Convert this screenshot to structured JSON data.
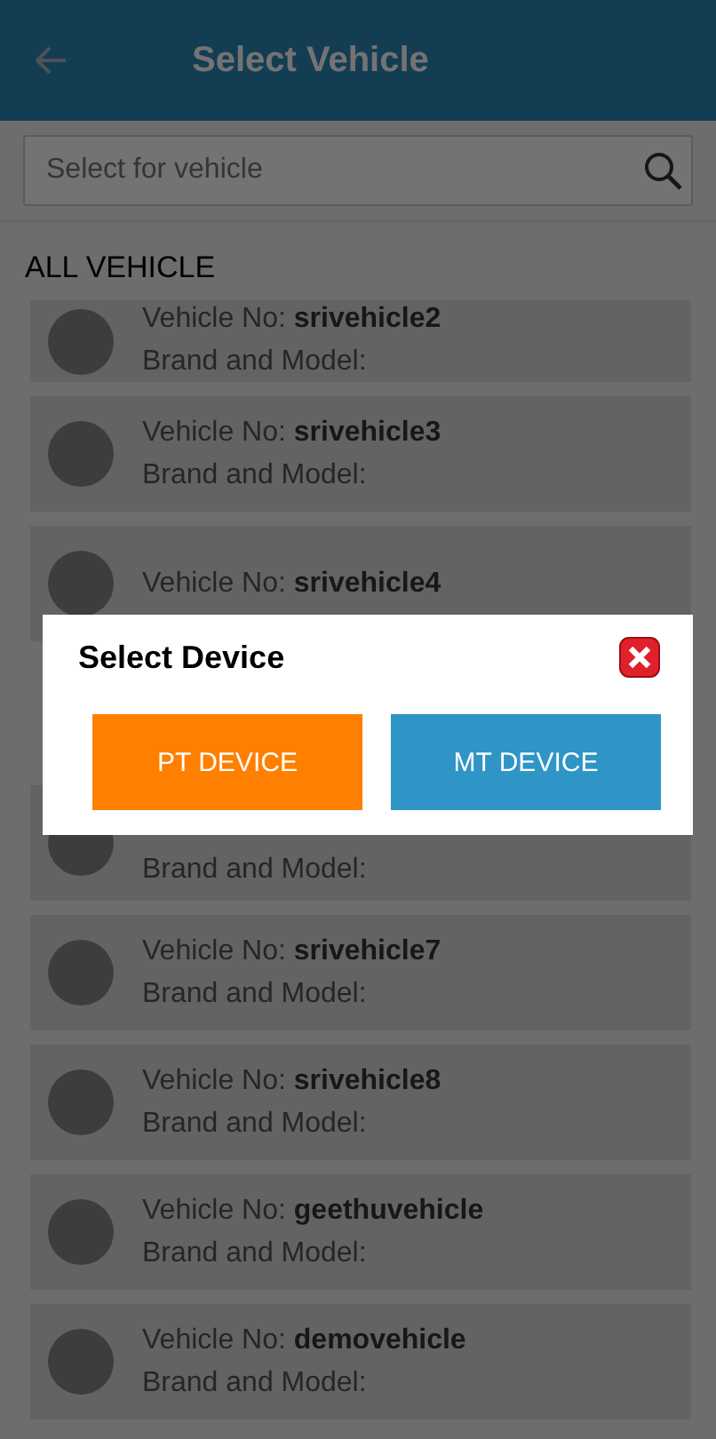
{
  "header": {
    "title": "Select Vehicle"
  },
  "search": {
    "placeholder": "Select for vehicle"
  },
  "section_title": "ALL VEHICLE",
  "vehicles": [
    {
      "label": "Vehicle No:",
      "number": "srivehicle2",
      "brand_label": "Brand and Model:"
    },
    {
      "label": "Vehicle No:",
      "number": "srivehicle3",
      "brand_label": "Brand and Model:"
    },
    {
      "label": "Vehicle No:",
      "number": "srivehicle4"
    },
    {
      "brand_label": "Brand and Model:"
    },
    {
      "label": "Vehicle No:",
      "number": "srivehicle7",
      "brand_label": "Brand and Model:"
    },
    {
      "label": "Vehicle No:",
      "number": "srivehicle8",
      "brand_label": "Brand and Model:"
    },
    {
      "label": "Vehicle No:",
      "number": "geethuvehicle",
      "brand_label": "Brand and Model:"
    },
    {
      "label": "Vehicle No:",
      "number": "demovehicle",
      "brand_label": "Brand and Model:"
    }
  ],
  "dialog": {
    "title": "Select Device",
    "buttons": [
      {
        "label": "PT DEVICE",
        "color": "#ff7f00"
      },
      {
        "label": "MT DEVICE",
        "color": "#2e95c6"
      }
    ]
  }
}
